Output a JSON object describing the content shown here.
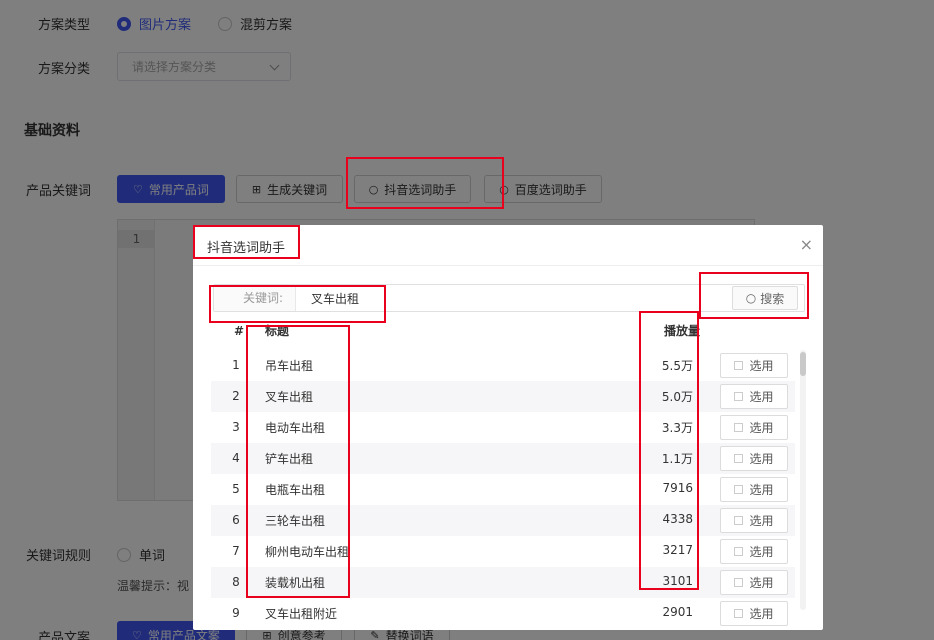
{
  "form": {
    "plan_type_label": "方案类型",
    "plan_type_options": [
      {
        "label": "图片方案",
        "selected": true
      },
      {
        "label": "混剪方案",
        "selected": false
      }
    ],
    "plan_category_label": "方案分类",
    "plan_category_placeholder": "请选择方案分类",
    "section_basic": "基础资料",
    "product_keywords_label": "产品关键词",
    "keyword_buttons": [
      {
        "label": "常用产品词",
        "icon": "heart-icon",
        "primary": true
      },
      {
        "label": "生成关键词",
        "icon": "document-plus-icon",
        "primary": false
      },
      {
        "label": "抖音选词助手",
        "icon": "search-icon",
        "primary": false
      },
      {
        "label": "百度选词助手",
        "icon": "search-icon",
        "primary": false
      }
    ],
    "editor_line_number": "1",
    "keyword_rule_label": "关键词规则",
    "keyword_rule_option": "单词",
    "tip_text": "温馨提示：视",
    "product_copy_label": "产品文案",
    "copy_buttons": [
      {
        "label": "常用产品文案",
        "icon": "heart-icon",
        "primary": true
      },
      {
        "label": "创意参考",
        "icon": "document-plus-icon",
        "primary": false
      },
      {
        "label": "替换词语",
        "icon": "edit-icon",
        "primary": false
      }
    ]
  },
  "dialog": {
    "title": "抖音选词助手",
    "close_glyph": "×",
    "keyword_label": "关键词:",
    "keyword_value": "叉车出租",
    "search_label": "搜索",
    "columns": {
      "index": "#",
      "title": "标题",
      "plays": "播放量"
    },
    "pick_label": "选用",
    "rows": [
      {
        "index": "1",
        "title": "吊车出租",
        "plays": "5.5万"
      },
      {
        "index": "2",
        "title": "叉车出租",
        "plays": "5.0万"
      },
      {
        "index": "3",
        "title": "电动车出租",
        "plays": "3.3万"
      },
      {
        "index": "4",
        "title": "铲车出租",
        "plays": "1.1万"
      },
      {
        "index": "5",
        "title": "电瓶车出租",
        "plays": "7916"
      },
      {
        "index": "6",
        "title": "三轮车出租",
        "plays": "4338"
      },
      {
        "index": "7",
        "title": "柳州电动车出租",
        "plays": "3217"
      },
      {
        "index": "8",
        "title": "装载机出租",
        "plays": "3101"
      },
      {
        "index": "9",
        "title": "叉车出租附近",
        "plays": "2901"
      }
    ]
  },
  "colors": {
    "primary": "#4058f4",
    "highlight": "#e8001c",
    "overlay": "rgba(0,0,0,0.5)"
  }
}
